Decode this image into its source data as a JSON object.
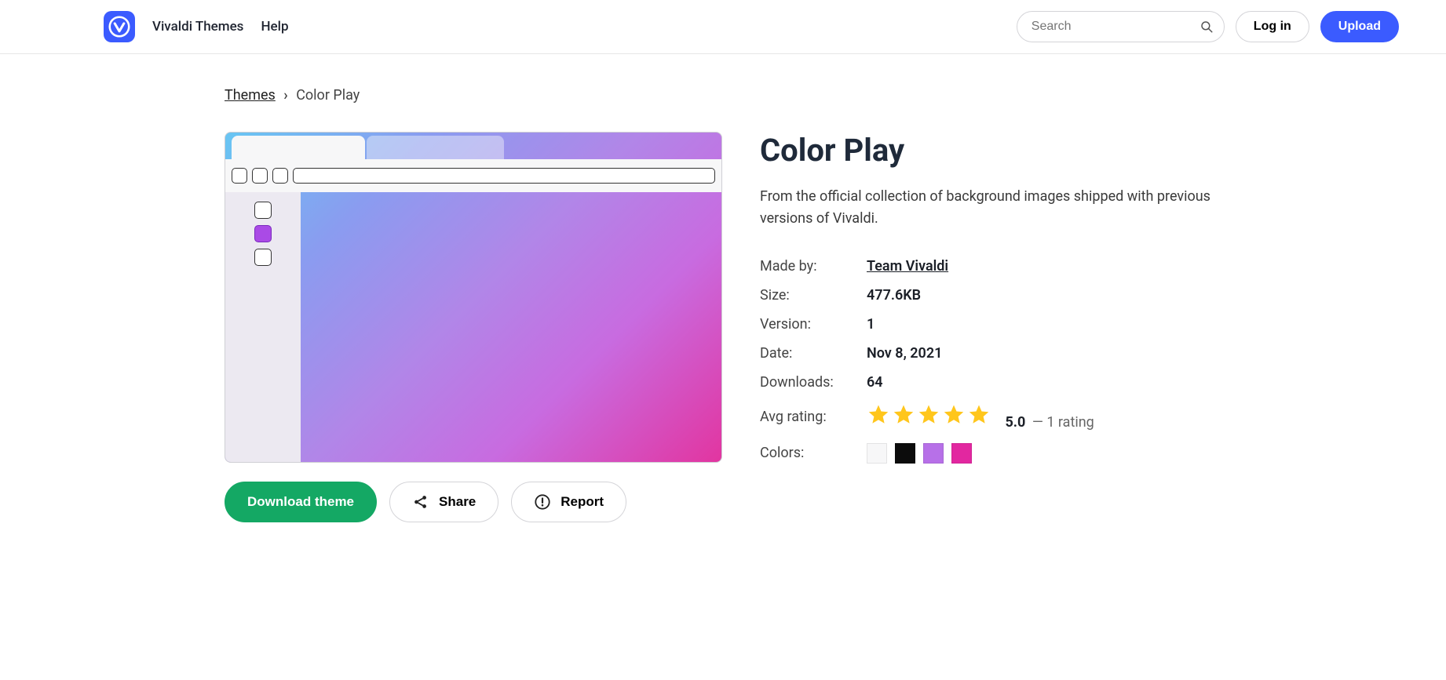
{
  "header": {
    "nav_themes": "Vivaldi Themes",
    "nav_help": "Help",
    "search_placeholder": "Search",
    "login_label": "Log in",
    "upload_label": "Upload"
  },
  "breadcrumb": {
    "root": "Themes",
    "current": "Color Play"
  },
  "theme": {
    "title": "Color Play",
    "description": "From the official collection of background images shipped with previous versions of Vivaldi.",
    "made_by_label": "Made by:",
    "made_by": "Team Vivaldi",
    "size_label": "Size:",
    "size": "477.6KB",
    "version_label": "Version:",
    "version": "1",
    "date_label": "Date:",
    "date": "Nov 8, 2021",
    "downloads_label": "Downloads:",
    "downloads": "64",
    "rating_label": "Avg rating:",
    "rating_value": "5.0",
    "rating_sub": " — 1 rating",
    "colors_label": "Colors:",
    "colors": [
      "#f7f7f8",
      "#0c0c0c",
      "#b770e8",
      "#e227a0"
    ]
  },
  "actions": {
    "download": "Download theme",
    "share": "Share",
    "report": "Report"
  }
}
